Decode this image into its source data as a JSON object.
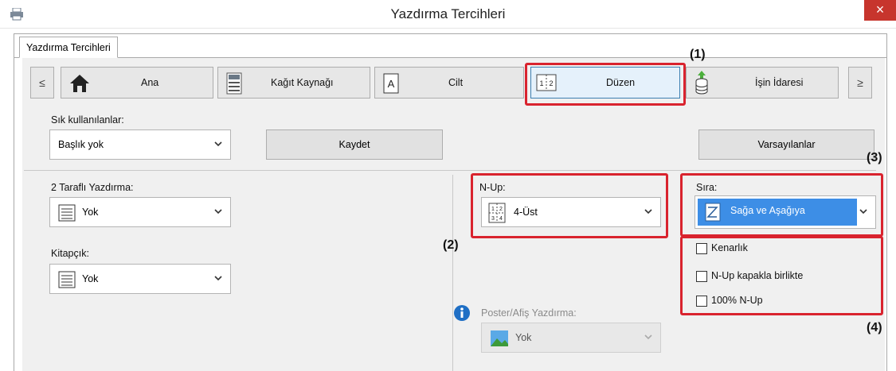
{
  "window": {
    "title": "Yazdırma Tercihleri",
    "close": "×"
  },
  "tab": {
    "label": "Yazdırma Tercihleri"
  },
  "nav": {
    "prev": "≤",
    "next": "≥",
    "items": [
      "Ana",
      "Kağıt Kaynağı",
      "Cilt",
      "Düzen",
      "İşin İdaresi"
    ],
    "selected": "Düzen"
  },
  "favorites": {
    "label": "Sık kullanılanlar:",
    "value": "Başlık yok",
    "save_button": "Kaydet",
    "defaults_button": "Varsayılanlar"
  },
  "duplex": {
    "label": "2 Taraflı Yazdırma:",
    "value": "Yok"
  },
  "booklet": {
    "label": "Kitapçık:",
    "value": "Yok"
  },
  "nup": {
    "label": "N-Up:",
    "value": "4-Üst"
  },
  "order": {
    "label": "Sıra:",
    "value": "Sağa ve Aşağıya"
  },
  "options": {
    "border": "Kenarlık",
    "nup_with_cover": "N-Up kapakla birlikte",
    "nup_100": "100% N-Up"
  },
  "poster": {
    "label": "Poster/Afiş Yazdırma:",
    "value": "Yok"
  },
  "callouts": {
    "c1": "(1)",
    "c2": "(2)",
    "c3": "(3)",
    "c4": "(4)"
  },
  "colors": {
    "accent": "#d9232e",
    "selection": "#3d8ee6",
    "close_bg": "#c7352d"
  }
}
